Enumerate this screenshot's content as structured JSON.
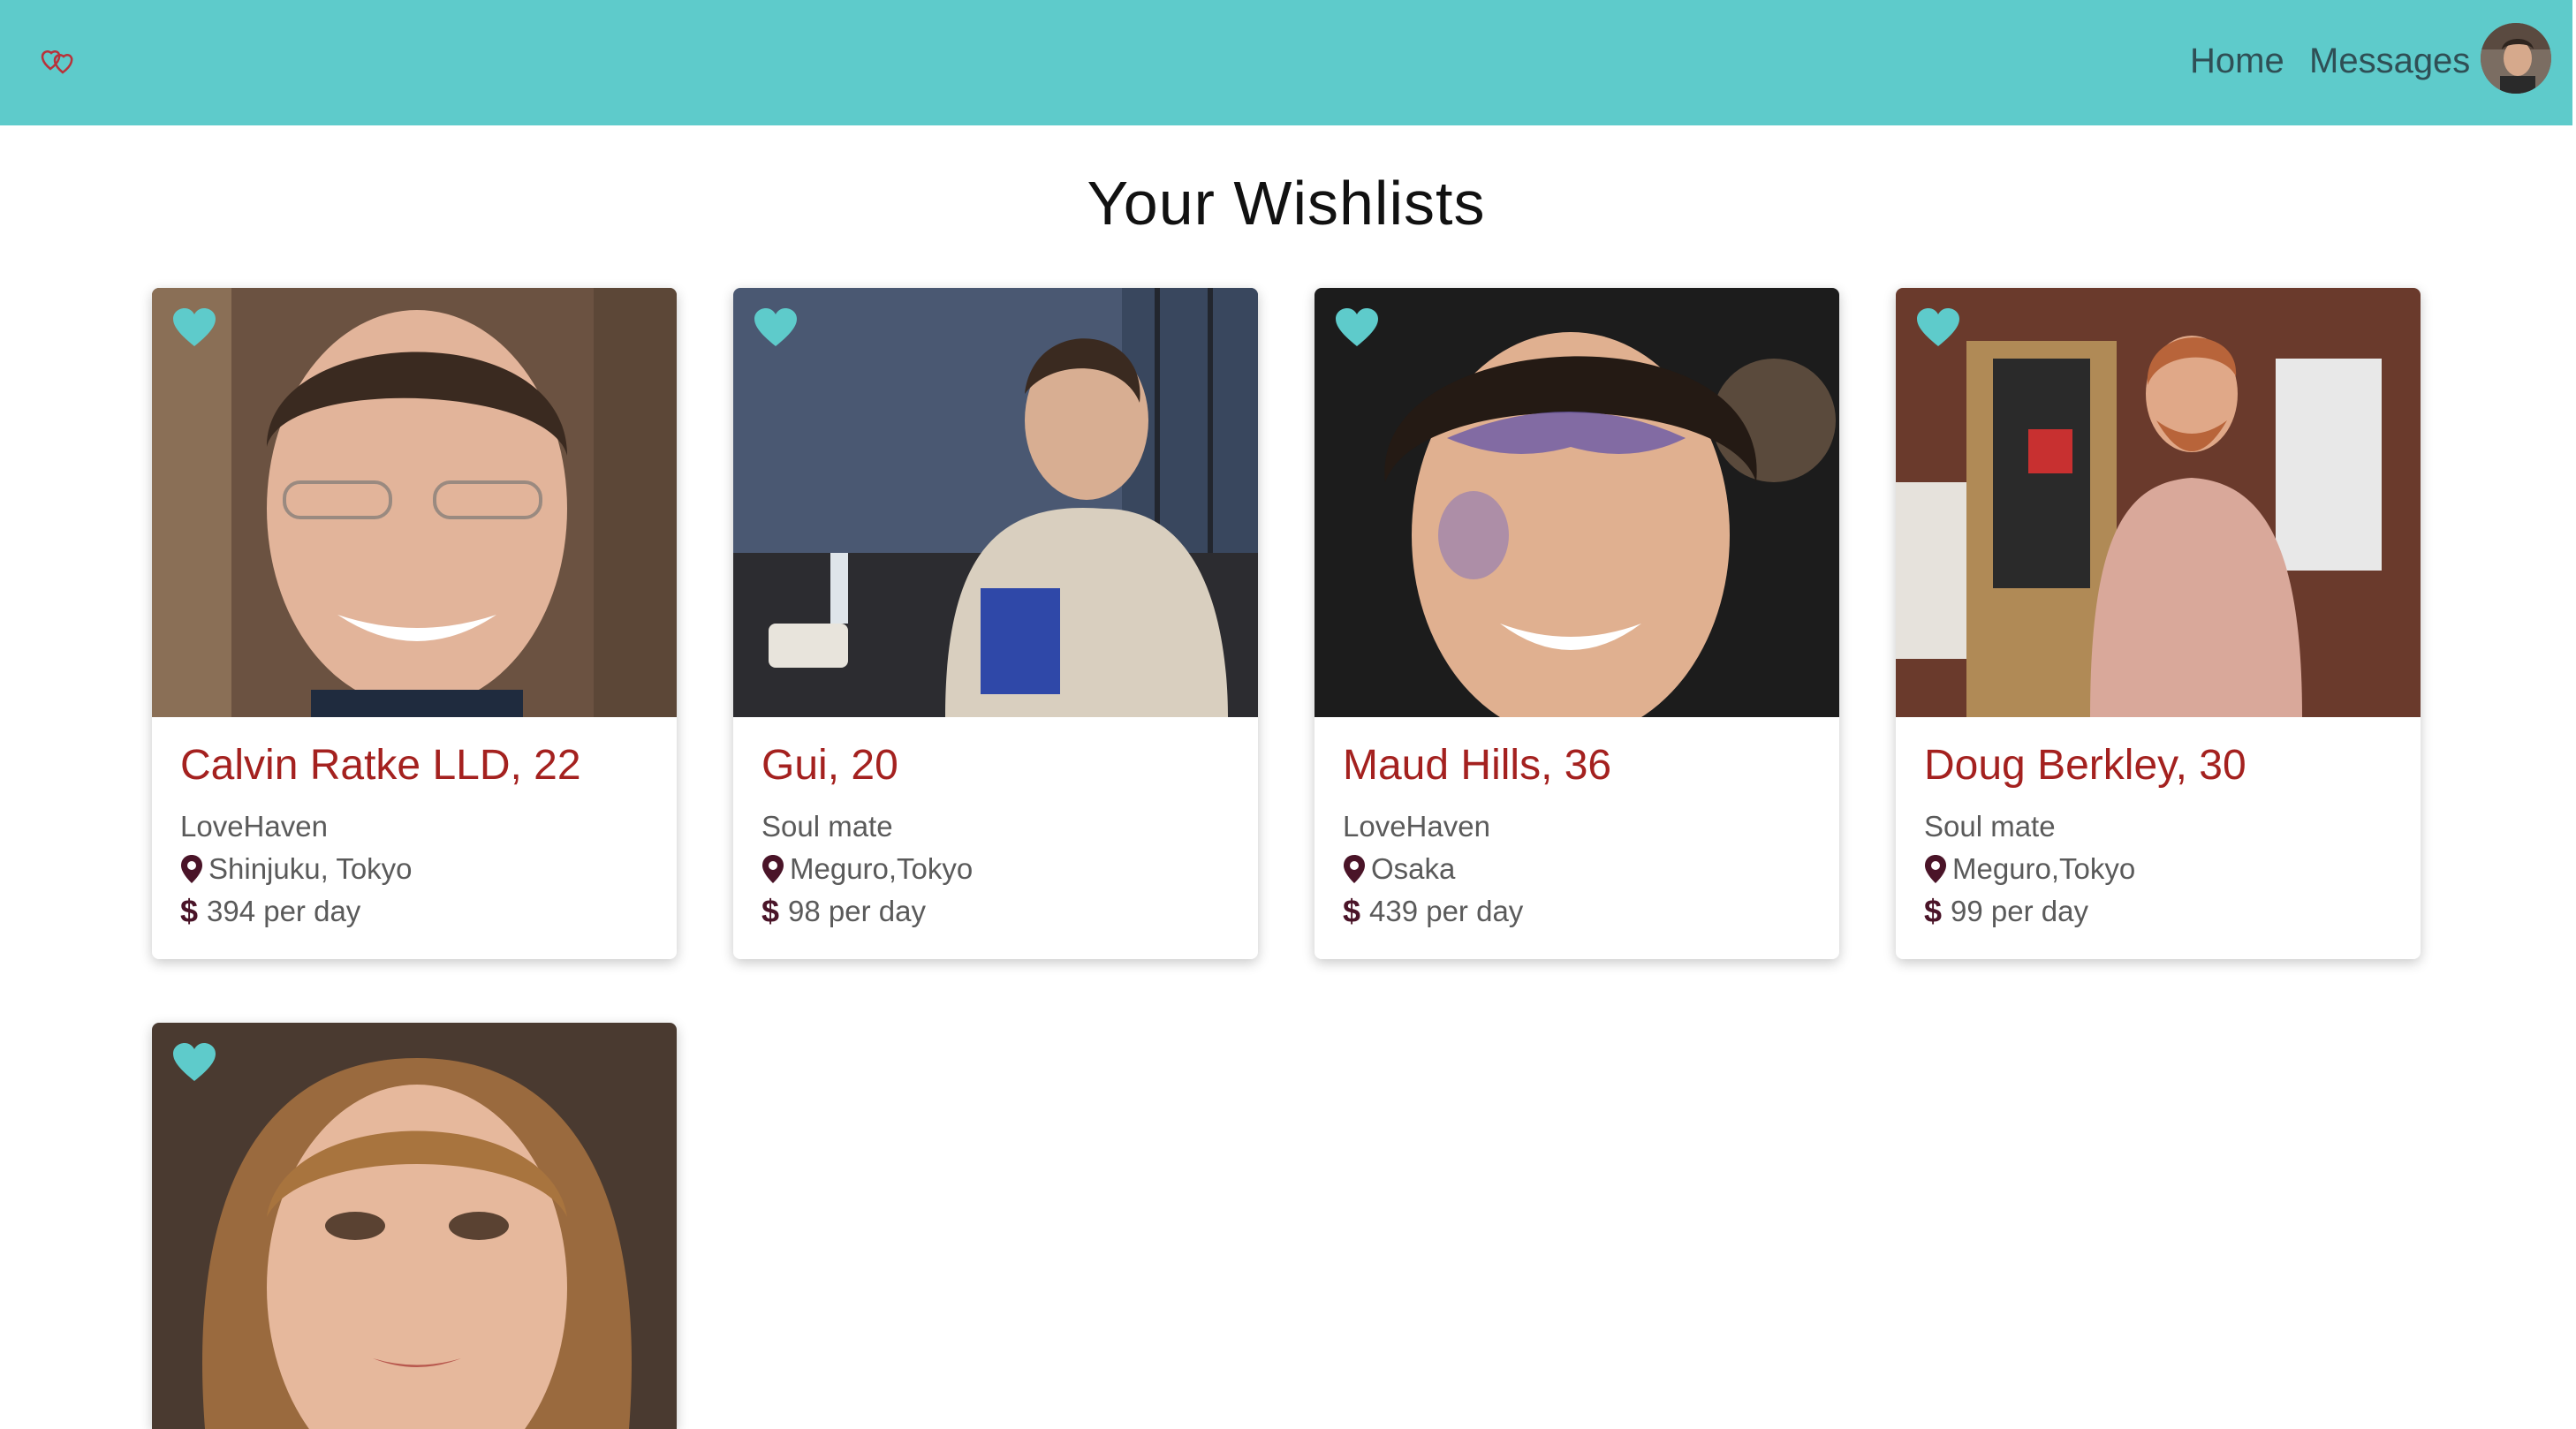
{
  "nav": {
    "logo_icon": "heart-pair-logo-icon",
    "home": "Home",
    "messages": "Messages",
    "avatar_icon": "user-avatar"
  },
  "page": {
    "title": "Your Wishlists"
  },
  "colors": {
    "topbar": "#5ecbcb",
    "name": "#a4211f",
    "heart": "#5ecbcb",
    "pin": "#4a1428"
  },
  "cards": [
    {
      "name": "Calvin Ratke LLD, 22",
      "tag": "LoveHaven",
      "location": "Shinjuku, Tokyo",
      "price": "394 per day",
      "wishlisted": true
    },
    {
      "name": "Gui, 20",
      "tag": "Soul mate",
      "location": "Meguro,Tokyo",
      "price": "98 per day",
      "wishlisted": true
    },
    {
      "name": "Maud Hills, 36",
      "tag": "LoveHaven",
      "location": "Osaka",
      "price": "439 per day",
      "wishlisted": true
    },
    {
      "name": "Doug Berkley, 30",
      "tag": "Soul mate",
      "location": "Meguro,Tokyo",
      "price": "99 per day",
      "wishlisted": true
    },
    {
      "wishlisted": true
    }
  ]
}
